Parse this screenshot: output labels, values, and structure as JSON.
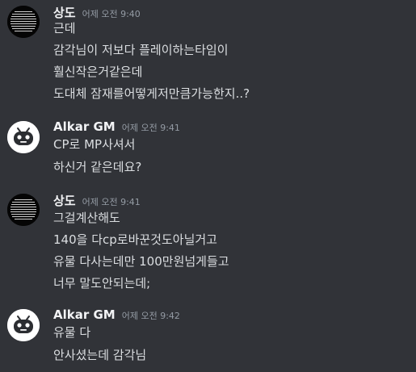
{
  "messages": [
    {
      "author": "상도",
      "timestamp": "어제 오전 9:40",
      "avatar": "dark-text-avatar-icon",
      "lines": [
        "근데",
        "감각님이 저보다 플레이하는타임이",
        "훨신작은거같은데",
        "도대체 잠재를어떻게저만큼가능한지..?"
      ]
    },
    {
      "author": "Alkar GM",
      "timestamp": "어제 오전 9:41",
      "avatar": "robot-face-icon",
      "lines": [
        "CP로 MP사셔서",
        "하신거 같은데요?"
      ]
    },
    {
      "author": "상도",
      "timestamp": "어제 오전 9:41",
      "avatar": "dark-text-avatar-icon",
      "lines": [
        "그걸계산해도",
        "140을 다cp로바꾼것도아닐거고",
        "유물 다사는데만 100만원넘게들고",
        "너무 말도안되는데;"
      ]
    },
    {
      "author": "Alkar GM",
      "timestamp": "어제 오전 9:42",
      "avatar": "robot-face-icon",
      "lines": [
        "유물 다",
        "안사셨는데 감각님"
      ]
    }
  ]
}
